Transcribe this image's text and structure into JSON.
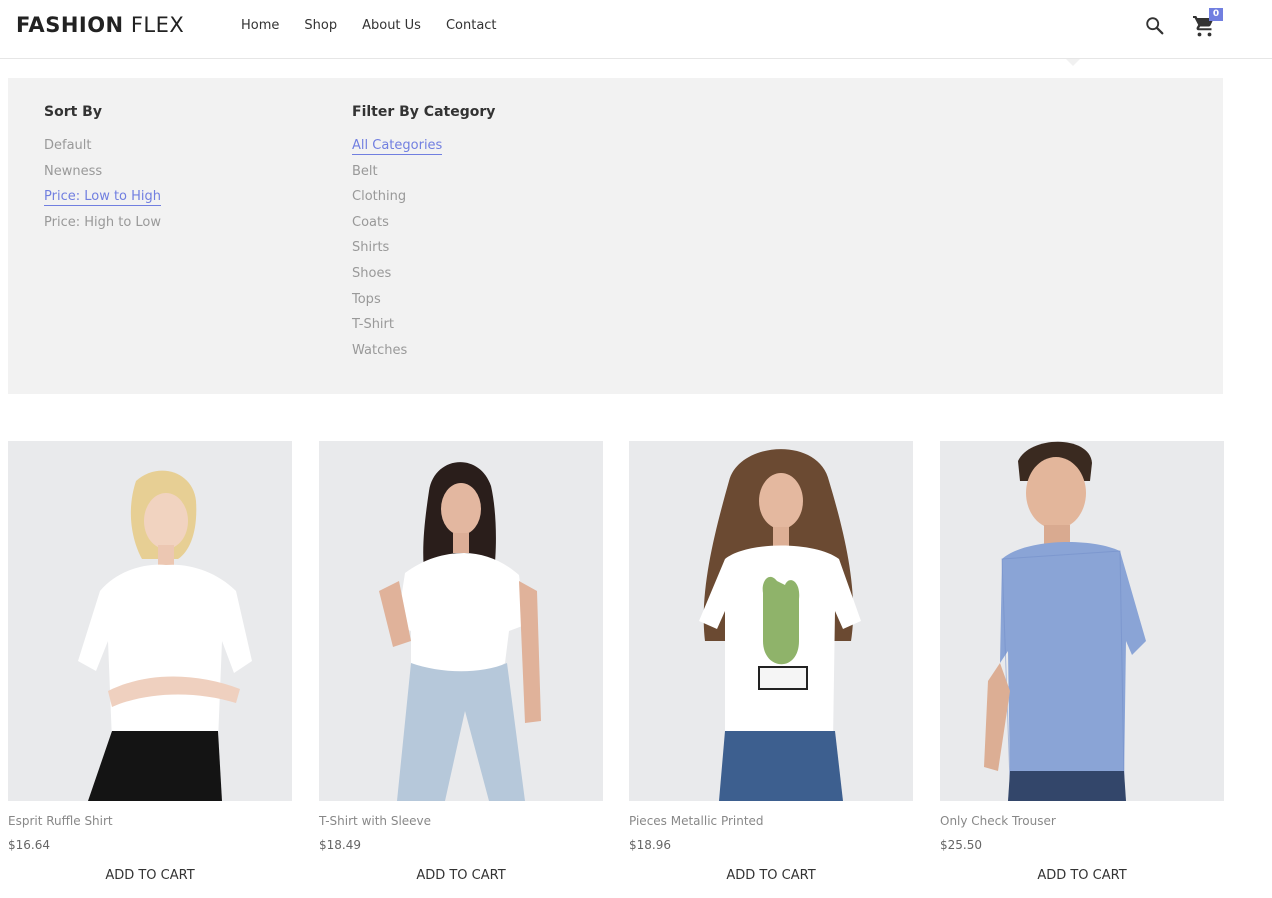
{
  "header": {
    "logo_bold": "FASHION",
    "logo_light": " FLEX",
    "nav": [
      "Home",
      "Shop",
      "About Us",
      "Contact"
    ],
    "cart_count": "0",
    "icons": {
      "search": "search-icon",
      "cart": "cart-icon"
    },
    "accent_color": "#717fe0"
  },
  "filter_panel": {
    "sort": {
      "title": "Sort By",
      "options": [
        "Default",
        "Newness",
        "Price: Low to High",
        "Price: High to Low"
      ],
      "selected": "Price: Low to High"
    },
    "category": {
      "title": "Filter By Category",
      "options": [
        "All Categories",
        "Belt",
        "Clothing",
        "Coats",
        "Shirts",
        "Shoes",
        "Tops",
        "T-Shirt",
        "Watches"
      ],
      "selected": "All Categories"
    }
  },
  "products": [
    {
      "name": "Esprit Ruffle Shirt",
      "price": "$16.64",
      "action": "ADD TO CART"
    },
    {
      "name": "T-Shirt with Sleeve",
      "price": "$18.49",
      "action": "ADD TO CART"
    },
    {
      "name": "Pieces Metallic Printed",
      "price": "$18.96",
      "action": "ADD TO CART"
    },
    {
      "name": "Only Check Trouser",
      "price": "$25.50",
      "action": "ADD TO CART"
    }
  ]
}
